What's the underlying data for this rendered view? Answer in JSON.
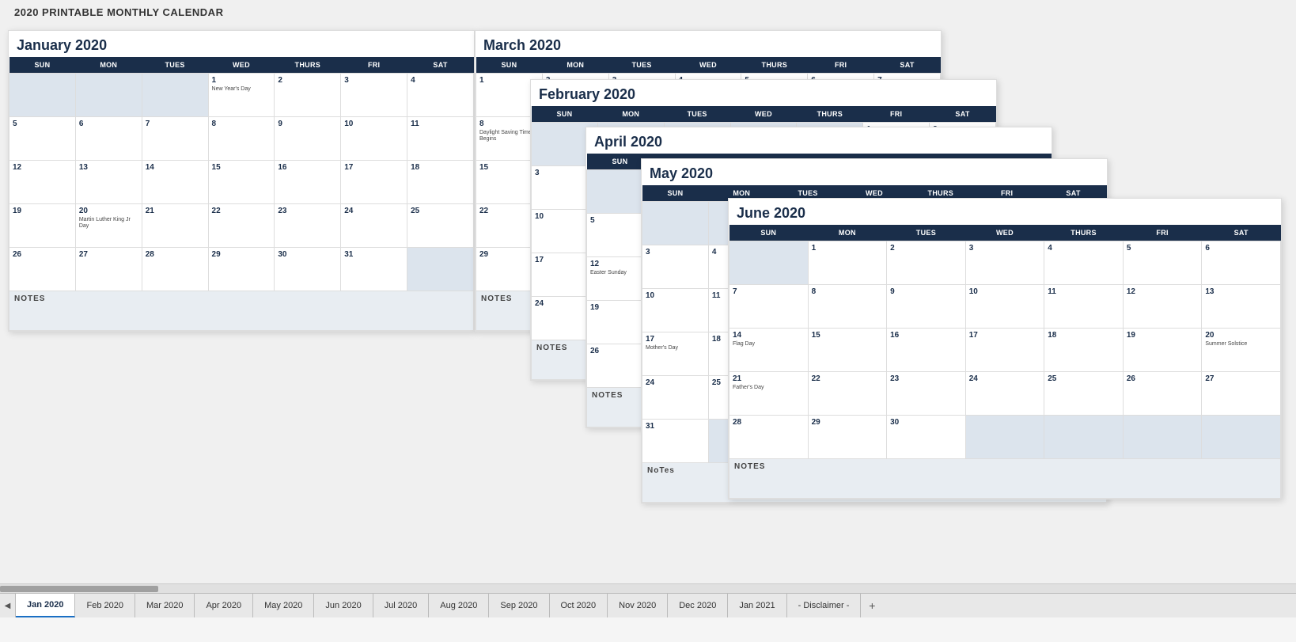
{
  "app": {
    "title": "2020 PRINTABLE MONTHLY CALENDAR"
  },
  "tabs": [
    {
      "label": "Jan 2020",
      "active": true
    },
    {
      "label": "Feb 2020",
      "active": false
    },
    {
      "label": "Mar 2020",
      "active": false
    },
    {
      "label": "Apr 2020",
      "active": false
    },
    {
      "label": "May 2020",
      "active": false
    },
    {
      "label": "Jun 2020",
      "active": false
    },
    {
      "label": "Jul 2020",
      "active": false
    },
    {
      "label": "Aug 2020",
      "active": false
    },
    {
      "label": "Sep 2020",
      "active": false
    },
    {
      "label": "Oct 2020",
      "active": false
    },
    {
      "label": "Nov 2020",
      "active": false
    },
    {
      "label": "Dec 2020",
      "active": false
    },
    {
      "label": "Jan 2021",
      "active": false
    },
    {
      "label": "- Disclaimer -",
      "active": false
    }
  ],
  "calendars": {
    "january": {
      "title": "January 2020",
      "notes_label": "NOTES"
    },
    "february": {
      "title": "February 2020",
      "notes_label": "NOTES"
    },
    "march": {
      "title": "March 2020",
      "notes_label": "NOTES"
    },
    "april": {
      "title": "April 2020",
      "notes_label": "NOTES"
    },
    "may": {
      "title": "May 2020",
      "notes_label": "NOTES"
    },
    "june": {
      "title": "June 2020",
      "notes_label": "NOTES"
    }
  },
  "days_header": [
    "SUN",
    "MON",
    "TUES",
    "WED",
    "THURS",
    "FRI",
    "SAT"
  ],
  "days_header_6col": [
    "SUN",
    "MON",
    "TUES",
    "WED",
    "THURS",
    "FRI"
  ]
}
